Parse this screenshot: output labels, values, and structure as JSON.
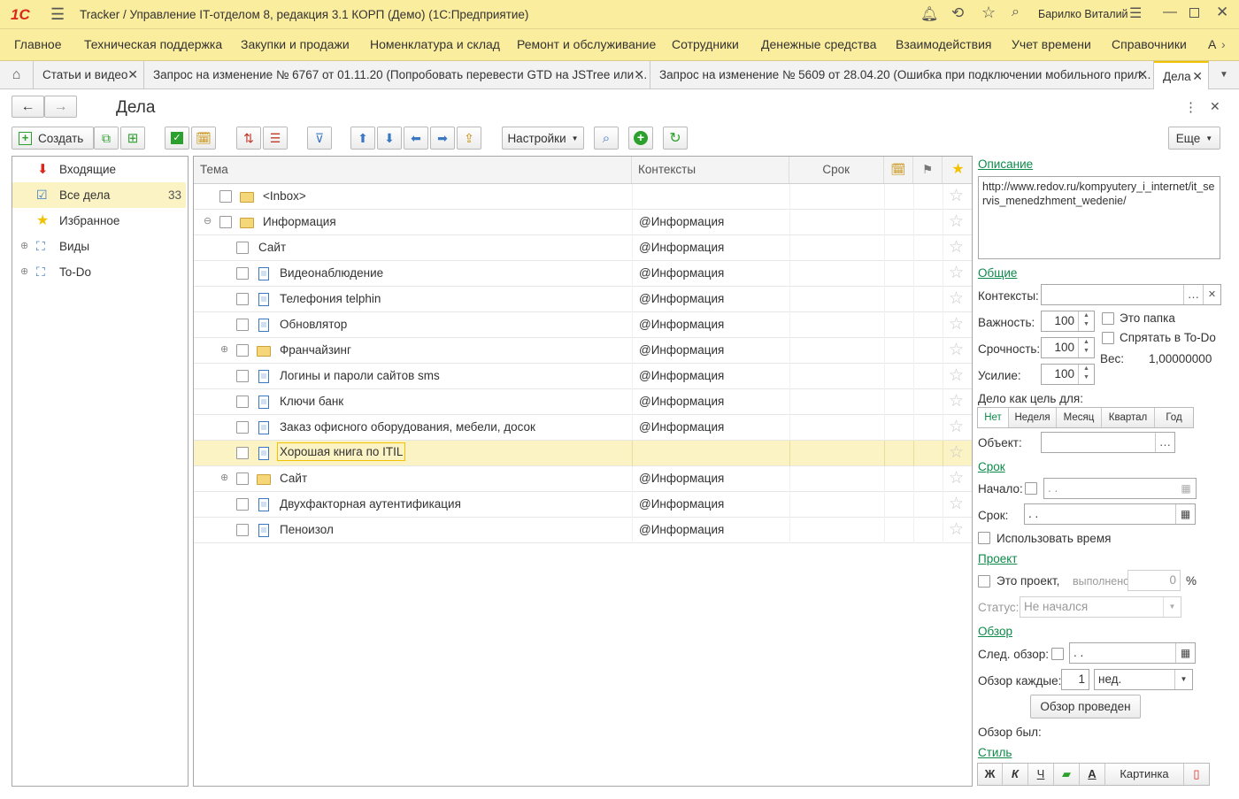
{
  "window": {
    "title": "Tracker / Управление IT-отделом 8, редакция 3.1 КОРП (Демо)  (1С:Предприятие)",
    "user": "Барилко Виталий",
    "logo": "1С"
  },
  "menu": [
    "Главное",
    "Техническая поддержка",
    "Закупки и продажи",
    "Номенклатура и склад",
    "Ремонт и обслуживание",
    "Сотрудники",
    "Денежные средства",
    "Взаимодействия",
    "Учет времени",
    "Справочники",
    "А"
  ],
  "tabs": [
    {
      "label": "Статьи и видео"
    },
    {
      "label": "Запрос на изменение № 6767 от 01.11.20 (Попробовать перевести GTD на JSTree или ..."
    },
    {
      "label": "Запрос на изменение № 5609 от 28.04.20 (Ошибка при подключении мобильного прил..."
    },
    {
      "label": "Дела"
    }
  ],
  "page": {
    "title": "Дела",
    "create": "Создать",
    "settings": "Настройки",
    "more": "Еще"
  },
  "nav": [
    {
      "label": "Входящие",
      "icon": "inbox-icon"
    },
    {
      "label": "Все дела",
      "icon": "checklist-icon",
      "count": "33",
      "selected": true
    },
    {
      "label": "Избранное",
      "icon": "star-icon"
    },
    {
      "label": "Виды",
      "icon": "tree-icon",
      "expand": "⊕"
    },
    {
      "label": "To-Do",
      "icon": "tree-icon",
      "expand": "⊕"
    }
  ],
  "table": {
    "headers": {
      "theme": "Тема",
      "contexts": "Контексты",
      "due": "Срок"
    },
    "rows": [
      {
        "label": "<Inbox>",
        "ctx": "",
        "type": "folder",
        "indent": 0,
        "expand": ""
      },
      {
        "label": "Информация",
        "ctx": "@Информация",
        "type": "folder",
        "indent": 0,
        "expand": "⊖"
      },
      {
        "label": "Сайт",
        "ctx": "@Информация",
        "type": "none",
        "indent": 1,
        "expand": ""
      },
      {
        "label": "Видеонаблюдение",
        "ctx": "@Информация",
        "type": "doc",
        "indent": 1,
        "expand": ""
      },
      {
        "label": "Телефония telphin",
        "ctx": "@Информация",
        "type": "doc",
        "indent": 1,
        "expand": ""
      },
      {
        "label": "Обновлятор",
        "ctx": "@Информация",
        "type": "doc",
        "indent": 1,
        "expand": ""
      },
      {
        "label": "Франчайзинг",
        "ctx": "@Информация",
        "type": "folder",
        "indent": 1,
        "expand": "⊕"
      },
      {
        "label": "Логины и пароли сайтов sms",
        "ctx": "@Информация",
        "type": "doc",
        "indent": 1,
        "expand": ""
      },
      {
        "label": "Ключи банк",
        "ctx": "@Информация",
        "type": "doc",
        "indent": 1,
        "expand": ""
      },
      {
        "label": "Заказ офисного оборудования, мебели, досок",
        "ctx": "@Информация",
        "type": "doc",
        "indent": 1,
        "expand": ""
      },
      {
        "label": "Хорошая книга по ITIL",
        "ctx": "",
        "type": "doc",
        "indent": 1,
        "expand": "",
        "selected": true
      },
      {
        "label": "Сайт",
        "ctx": "@Информация",
        "type": "folder",
        "indent": 1,
        "expand": "⊕"
      },
      {
        "label": "Двухфакторная аутентификация",
        "ctx": "@Информация",
        "type": "doc",
        "indent": 1,
        "expand": ""
      },
      {
        "label": "Пеноизол",
        "ctx": "@Информация",
        "type": "doc",
        "indent": 1,
        "expand": ""
      }
    ]
  },
  "details": {
    "description_link": "Описание",
    "description": "http://www.redov.ru/kompyutery_i_internet/it_servis_menedzhment_wedenie/",
    "general_link": "Общие",
    "contexts_label": "Контексты:",
    "importance_label": "Важность:",
    "importance": "100",
    "urgency_label": "Срочность:",
    "urgency": "100",
    "effort_label": "Усилие:",
    "effort": "100",
    "is_folder": "Это папка",
    "hide_todo": "Спрятать в To-Do",
    "weight_label": "Вес:",
    "weight": "1,00000000",
    "goal_label": "Дело как цель для:",
    "goal_options": [
      "Нет",
      "Неделя",
      "Месяц",
      "Квартал",
      "Год"
    ],
    "object_label": "Объект:",
    "due_link": "Срок",
    "start_label": "Начало:",
    "start_value": " .  .",
    "due_label": "Срок:",
    "due_value": " .  .",
    "use_time": "Использовать время",
    "project_link": "Проект",
    "is_project": "Это проект,",
    "done_label": "выполнено:",
    "done_value": "0",
    "percent": "%",
    "status_label": "Статус:",
    "status_value": "Не начался",
    "review_link": "Обзор",
    "next_review_label": "След. обзор:",
    "next_review_value": " .  .",
    "review_every_label": "Обзор каждые:",
    "review_every": "1",
    "review_unit": "нед.",
    "review_done_btn": "Обзор проведен",
    "review_was_label": "Обзор был:",
    "style_link": "Стиль",
    "style_buttons": [
      "Ж",
      "К",
      "Ч"
    ],
    "picture_btn": "Картинка"
  },
  "colors": {
    "accent": "#fbed9e",
    "selected": "#fcf3c5",
    "link": "#0e8a4a",
    "green": "#2ca02c",
    "blue": "#3b78c2"
  }
}
